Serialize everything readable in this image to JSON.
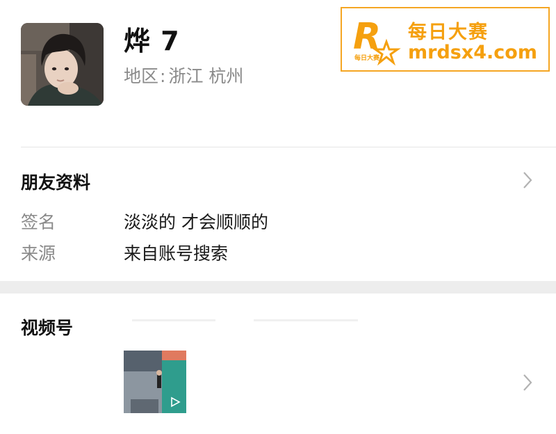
{
  "profile": {
    "nickname": "烨 7",
    "region_label": "地区",
    "region_sep": ":",
    "region_value": "浙江 杭州"
  },
  "watermark": {
    "logo_letter": "R",
    "logo_sub": "每日大赛",
    "title": "每日大赛",
    "url": "mrdsx4.com",
    "color": "#f5a00f"
  },
  "friend_info": {
    "title": "朋友资料",
    "rows": [
      {
        "label": "签名",
        "value": "淡淡的 才会顺顺的"
      },
      {
        "label": "来源",
        "value": "来自账号搜索"
      }
    ]
  },
  "channels": {
    "title": "视频号",
    "thumbnail_icon": "play-icon"
  },
  "colors": {
    "text_primary": "#111111",
    "text_secondary": "#8a8a8a",
    "divider": "#e5e5e5",
    "section_gap": "#ededed",
    "chevron": "#b2b2b2"
  }
}
